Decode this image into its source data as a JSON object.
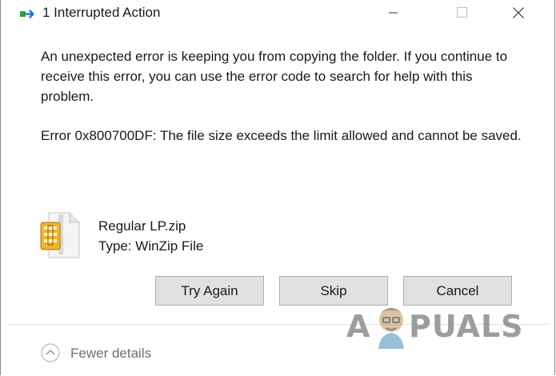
{
  "window": {
    "title": "1 Interrupted Action"
  },
  "message": "An unexpected error is keeping you from copying the folder. If you continue to receive this error, you can use the error code to search for help with this problem.",
  "error": "Error 0x800700DF: The file size exceeds the limit allowed and cannot be saved.",
  "file": {
    "name": "Regular LP.zip",
    "type": "Type: WinZip File",
    "icon": "zip-file-icon"
  },
  "buttons": {
    "try_again": "Try Again",
    "skip": "Skip",
    "cancel": "Cancel"
  },
  "footer": {
    "details_toggle": "Fewer details"
  },
  "watermark": {
    "text_left": "A",
    "text_right": "PUALS"
  },
  "colors": {
    "icon_green": "#2e9e3e",
    "icon_blue": "#1e73d6",
    "zip_yellow": "#f0b429",
    "button_bg": "#e1e1e1",
    "button_border": "#adadad",
    "footer_text": "#6e6e6e"
  }
}
